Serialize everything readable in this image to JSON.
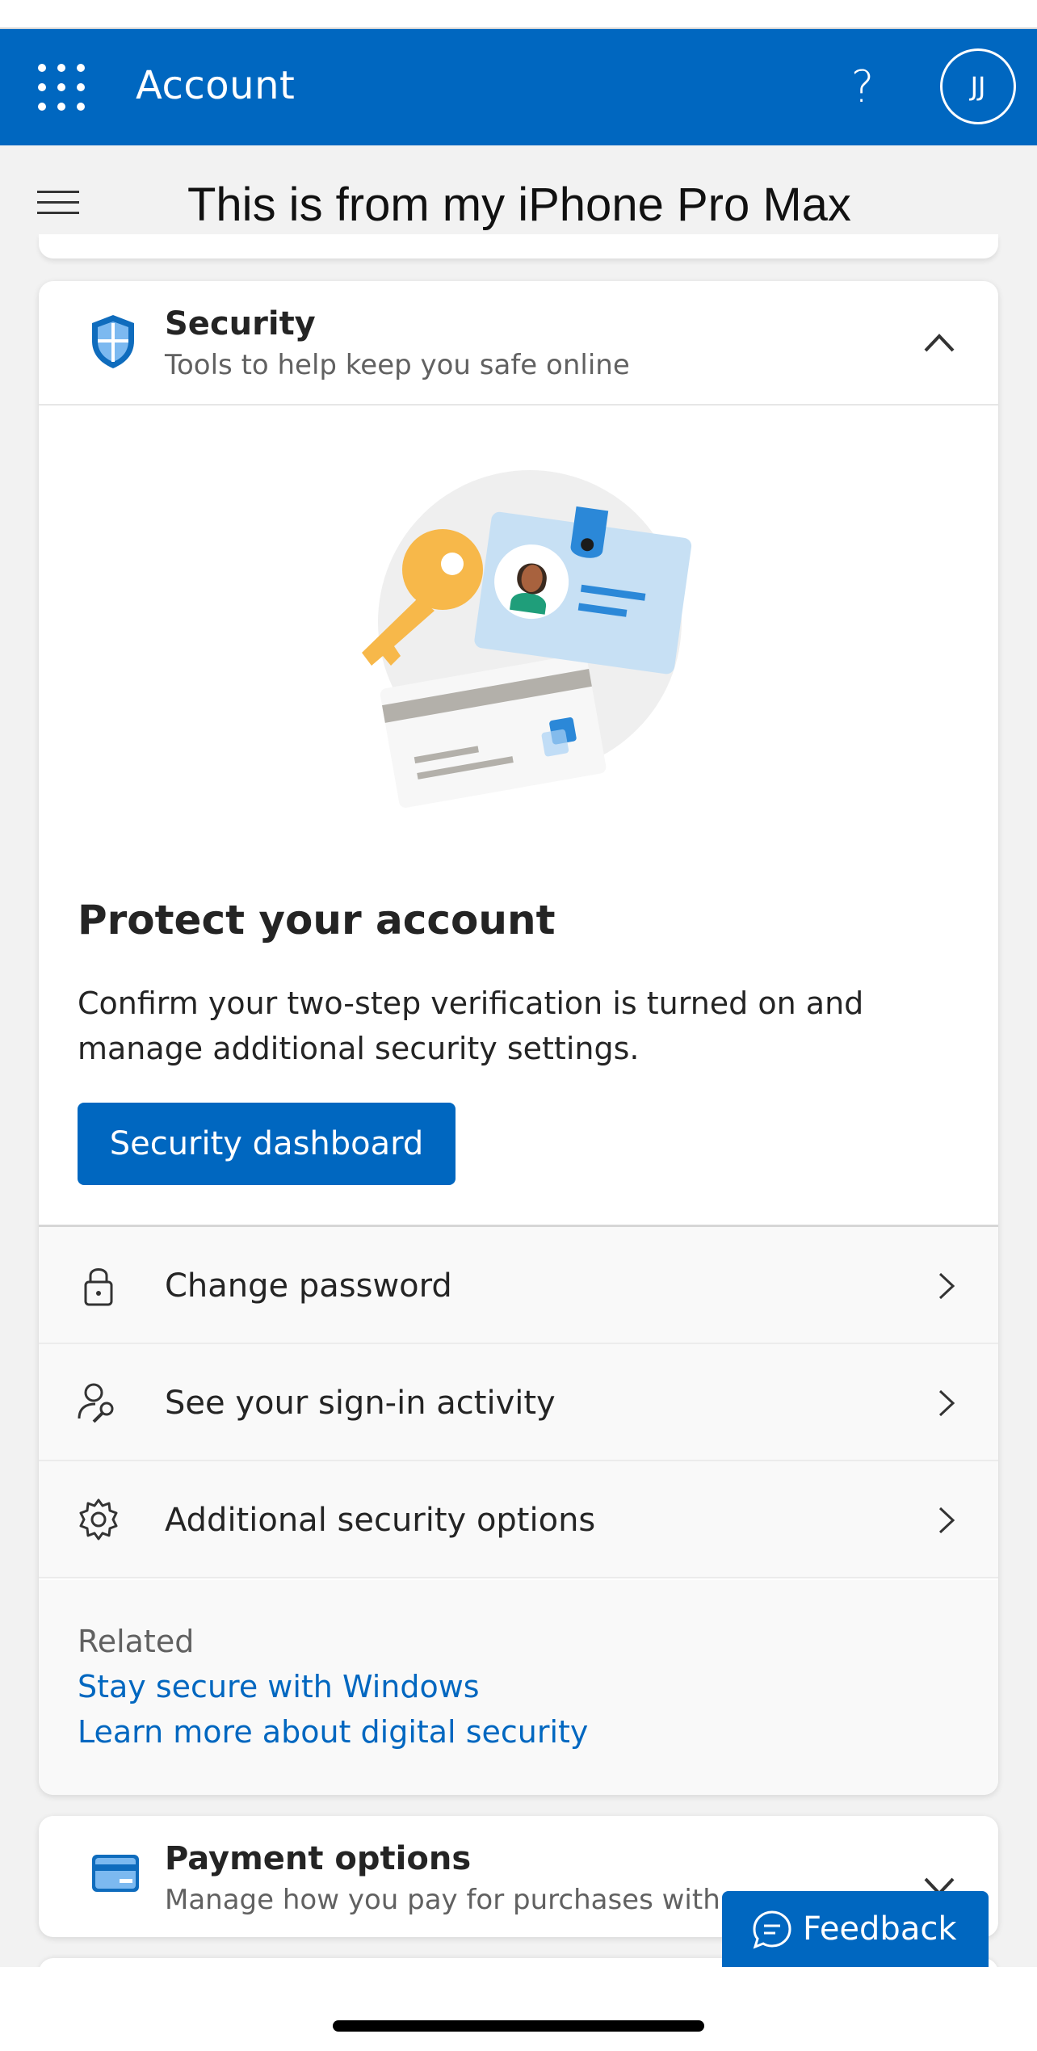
{
  "app": {
    "title": "Account",
    "help_glyph": "?",
    "avatar_initials": "JJ",
    "accent_color": "#0067c0"
  },
  "caption": "This is from my iPhone Pro Max",
  "security": {
    "title": "Security",
    "subtitle": "Tools to help keep you safe online",
    "heading": "Protect your account",
    "description": "Confirm your two-step verification is turned on and manage additional security settings.",
    "button_label": "Security dashboard",
    "items": [
      {
        "label": "Change password",
        "icon": "lock-icon"
      },
      {
        "label": "See your sign-in activity",
        "icon": "person-key-icon"
      },
      {
        "label": "Additional security options",
        "icon": "gear-icon"
      }
    ],
    "related": {
      "title": "Related",
      "links": [
        "Stay secure with Windows",
        "Learn more about digital security"
      ]
    }
  },
  "payment": {
    "title": "Payment options",
    "subtitle": "Manage how you pay for purchases with yo"
  },
  "feedback": {
    "label": "Feedback"
  }
}
